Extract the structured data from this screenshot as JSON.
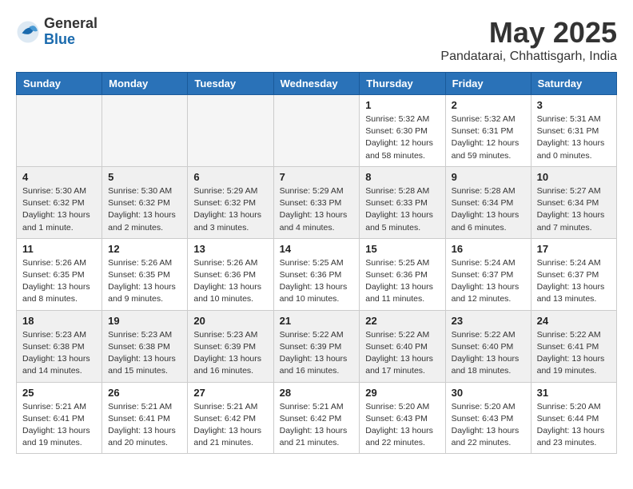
{
  "logo": {
    "general": "General",
    "blue": "Blue"
  },
  "title": {
    "month_year": "May 2025",
    "location": "Pandatarai, Chhattisgarh, India"
  },
  "weekdays": [
    "Sunday",
    "Monday",
    "Tuesday",
    "Wednesday",
    "Thursday",
    "Friday",
    "Saturday"
  ],
  "weeks": [
    [
      {
        "day": "",
        "info": ""
      },
      {
        "day": "",
        "info": ""
      },
      {
        "day": "",
        "info": ""
      },
      {
        "day": "",
        "info": ""
      },
      {
        "day": "1",
        "info": "Sunrise: 5:32 AM\nSunset: 6:30 PM\nDaylight: 12 hours\nand 58 minutes."
      },
      {
        "day": "2",
        "info": "Sunrise: 5:32 AM\nSunset: 6:31 PM\nDaylight: 12 hours\nand 59 minutes."
      },
      {
        "day": "3",
        "info": "Sunrise: 5:31 AM\nSunset: 6:31 PM\nDaylight: 13 hours\nand 0 minutes."
      }
    ],
    [
      {
        "day": "4",
        "info": "Sunrise: 5:30 AM\nSunset: 6:32 PM\nDaylight: 13 hours\nand 1 minute."
      },
      {
        "day": "5",
        "info": "Sunrise: 5:30 AM\nSunset: 6:32 PM\nDaylight: 13 hours\nand 2 minutes."
      },
      {
        "day": "6",
        "info": "Sunrise: 5:29 AM\nSunset: 6:32 PM\nDaylight: 13 hours\nand 3 minutes."
      },
      {
        "day": "7",
        "info": "Sunrise: 5:29 AM\nSunset: 6:33 PM\nDaylight: 13 hours\nand 4 minutes."
      },
      {
        "day": "8",
        "info": "Sunrise: 5:28 AM\nSunset: 6:33 PM\nDaylight: 13 hours\nand 5 minutes."
      },
      {
        "day": "9",
        "info": "Sunrise: 5:28 AM\nSunset: 6:34 PM\nDaylight: 13 hours\nand 6 minutes."
      },
      {
        "day": "10",
        "info": "Sunrise: 5:27 AM\nSunset: 6:34 PM\nDaylight: 13 hours\nand 7 minutes."
      }
    ],
    [
      {
        "day": "11",
        "info": "Sunrise: 5:26 AM\nSunset: 6:35 PM\nDaylight: 13 hours\nand 8 minutes."
      },
      {
        "day": "12",
        "info": "Sunrise: 5:26 AM\nSunset: 6:35 PM\nDaylight: 13 hours\nand 9 minutes."
      },
      {
        "day": "13",
        "info": "Sunrise: 5:26 AM\nSunset: 6:36 PM\nDaylight: 13 hours\nand 10 minutes."
      },
      {
        "day": "14",
        "info": "Sunrise: 5:25 AM\nSunset: 6:36 PM\nDaylight: 13 hours\nand 10 minutes."
      },
      {
        "day": "15",
        "info": "Sunrise: 5:25 AM\nSunset: 6:36 PM\nDaylight: 13 hours\nand 11 minutes."
      },
      {
        "day": "16",
        "info": "Sunrise: 5:24 AM\nSunset: 6:37 PM\nDaylight: 13 hours\nand 12 minutes."
      },
      {
        "day": "17",
        "info": "Sunrise: 5:24 AM\nSunset: 6:37 PM\nDaylight: 13 hours\nand 13 minutes."
      }
    ],
    [
      {
        "day": "18",
        "info": "Sunrise: 5:23 AM\nSunset: 6:38 PM\nDaylight: 13 hours\nand 14 minutes."
      },
      {
        "day": "19",
        "info": "Sunrise: 5:23 AM\nSunset: 6:38 PM\nDaylight: 13 hours\nand 15 minutes."
      },
      {
        "day": "20",
        "info": "Sunrise: 5:23 AM\nSunset: 6:39 PM\nDaylight: 13 hours\nand 16 minutes."
      },
      {
        "day": "21",
        "info": "Sunrise: 5:22 AM\nSunset: 6:39 PM\nDaylight: 13 hours\nand 16 minutes."
      },
      {
        "day": "22",
        "info": "Sunrise: 5:22 AM\nSunset: 6:40 PM\nDaylight: 13 hours\nand 17 minutes."
      },
      {
        "day": "23",
        "info": "Sunrise: 5:22 AM\nSunset: 6:40 PM\nDaylight: 13 hours\nand 18 minutes."
      },
      {
        "day": "24",
        "info": "Sunrise: 5:22 AM\nSunset: 6:41 PM\nDaylight: 13 hours\nand 19 minutes."
      }
    ],
    [
      {
        "day": "25",
        "info": "Sunrise: 5:21 AM\nSunset: 6:41 PM\nDaylight: 13 hours\nand 19 minutes."
      },
      {
        "day": "26",
        "info": "Sunrise: 5:21 AM\nSunset: 6:41 PM\nDaylight: 13 hours\nand 20 minutes."
      },
      {
        "day": "27",
        "info": "Sunrise: 5:21 AM\nSunset: 6:42 PM\nDaylight: 13 hours\nand 21 minutes."
      },
      {
        "day": "28",
        "info": "Sunrise: 5:21 AM\nSunset: 6:42 PM\nDaylight: 13 hours\nand 21 minutes."
      },
      {
        "day": "29",
        "info": "Sunrise: 5:20 AM\nSunset: 6:43 PM\nDaylight: 13 hours\nand 22 minutes."
      },
      {
        "day": "30",
        "info": "Sunrise: 5:20 AM\nSunset: 6:43 PM\nDaylight: 13 hours\nand 22 minutes."
      },
      {
        "day": "31",
        "info": "Sunrise: 5:20 AM\nSunset: 6:44 PM\nDaylight: 13 hours\nand 23 minutes."
      }
    ]
  ]
}
